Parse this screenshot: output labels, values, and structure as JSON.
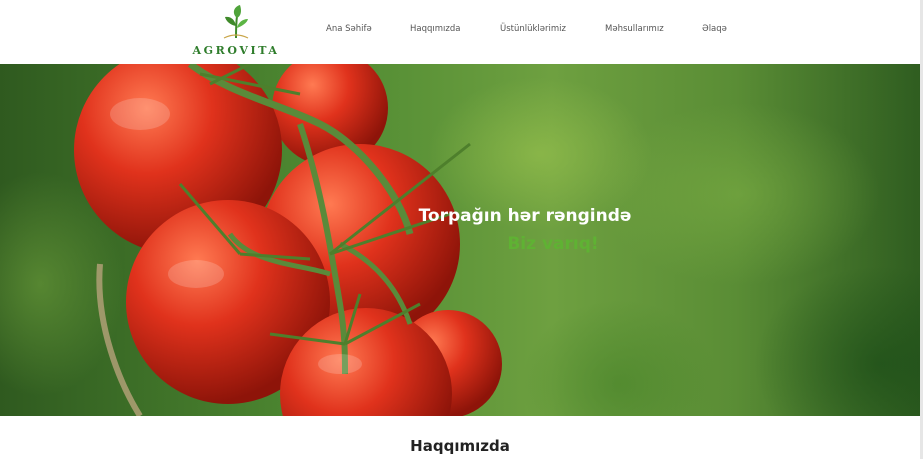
{
  "header": {
    "logo_text": "AGROVITA",
    "nav": [
      {
        "label": "Ana Səhifə"
      },
      {
        "label": "Haqqımızda"
      },
      {
        "label": "Üstünlüklərimiz"
      },
      {
        "label": "Məhsullarımız"
      },
      {
        "label": "Əlaqə"
      }
    ]
  },
  "hero": {
    "title": "Torpağın hər rəngində",
    "subtitle": "Biz varıq!"
  },
  "about": {
    "title": "Haqqımızda"
  }
}
